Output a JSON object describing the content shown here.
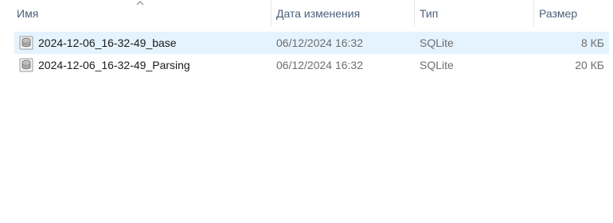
{
  "columns": {
    "name": "Имя",
    "date": "Дата изменения",
    "type": "Тип",
    "size": "Размер"
  },
  "sort": {
    "column": "name",
    "direction": "ascending"
  },
  "files": [
    {
      "name": "2024-12-06_16-32-49_base",
      "date": "06/12/2024 16:32",
      "type": "SQLite",
      "size": "8 КБ",
      "icon": "database-file-icon",
      "selected": true
    },
    {
      "name": "2024-12-06_16-32-49_Parsing",
      "date": "06/12/2024 16:32",
      "type": "SQLite",
      "size": "20 КБ",
      "icon": "database-file-icon",
      "selected": false
    }
  ],
  "colors": {
    "selection": "#e5f3ff",
    "header_text": "#4c607a",
    "secondary_text": "#6d6d6d"
  }
}
